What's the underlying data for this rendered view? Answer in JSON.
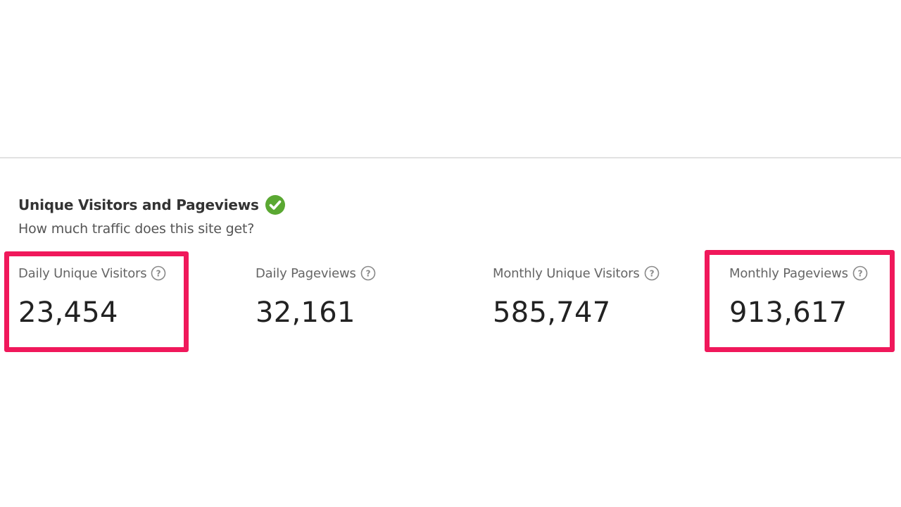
{
  "section": {
    "title": "Unique Visitors and Pageviews",
    "subtitle": "How much traffic does this site get?",
    "status_icon": "green-check-circle",
    "status_color": "#5aa832"
  },
  "metrics": [
    {
      "label": "Daily Unique Visitors",
      "value": "23,454",
      "highlighted": true
    },
    {
      "label": "Daily Pageviews",
      "value": "32,161",
      "highlighted": false
    },
    {
      "label": "Monthly Unique Visitors",
      "value": "585,747",
      "highlighted": false
    },
    {
      "label": "Monthly Pageviews",
      "value": "913,617",
      "highlighted": true
    }
  ],
  "colors": {
    "highlight": "#f0185b",
    "divider": "#e2e2e2"
  }
}
